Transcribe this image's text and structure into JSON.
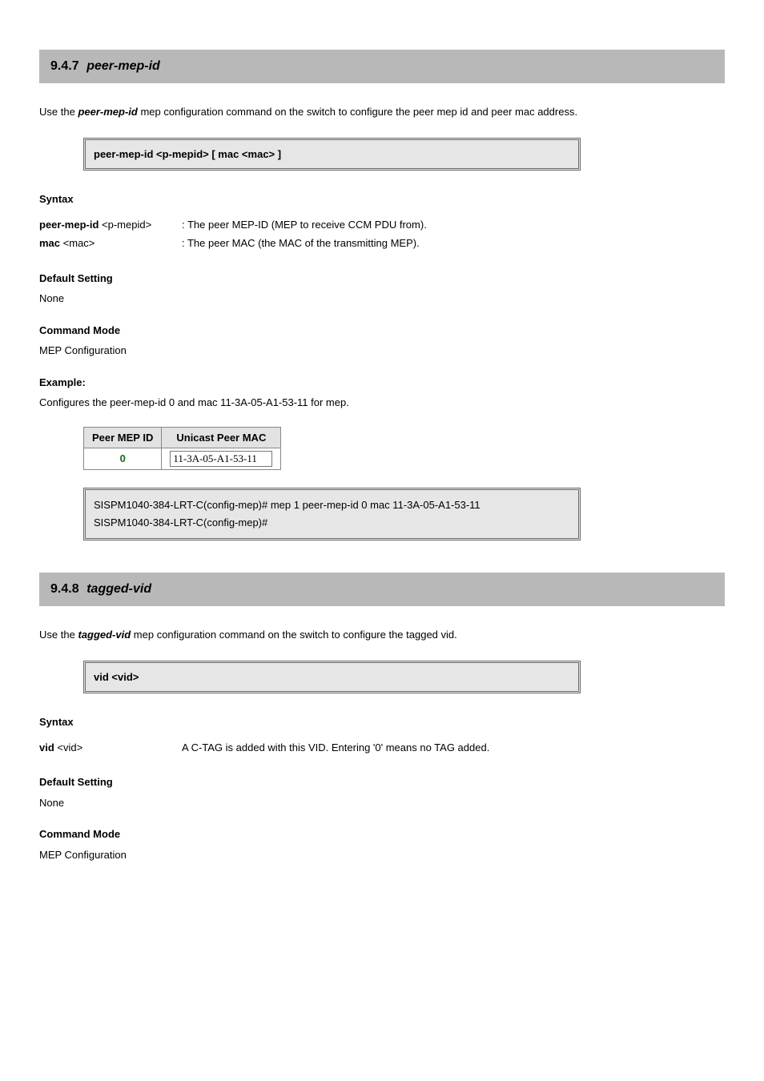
{
  "sections": [
    {
      "num": "9.4.7",
      "title": "peer-mep-id"
    },
    {
      "num": "9.4.8",
      "title": "tagged-vid"
    }
  ],
  "s1": {
    "intro_prefix": "Use the",
    "intro_func": "peer-mep-id",
    "intro_suffix": "mep configuration command on the switch to configure the peer mep id and peer mac address.",
    "syntax_box": "peer-mep-id <p-mepid> [ mac <mac> ]",
    "syntax_label": "Syntax",
    "params": {
      "p1_key": "peer-mep-id",
      "p1_type": "<p-mepid>",
      "p1_desc": ": The peer MEP-ID (MEP to receive CCM PDU from).",
      "p2_key": "mac",
      "p2_type": "<mac>",
      "p2_desc": ": The peer MAC (the MAC of the transmitting MEP)."
    },
    "default_head": "Default Setting",
    "default_body": "None",
    "mode_head": "Command Mode",
    "mode_body": "MEP Configuration",
    "example_head": "Example:",
    "example_text": "Configures the peer-mep-id 0 and mac 11-3A-05-A1-53-11 for mep.",
    "table": {
      "col1": "Peer MEP ID",
      "col2": "Unicast Peer MAC",
      "row1_id": "0",
      "row1_mac": "11-3A-05-A1-53-11"
    },
    "cmd_box": "SISPM1040-384-LRT-C(config-mep)# mep 1 peer-mep-id 0 mac 11-3A-05-A1-53-11\nSISPM1040-384-LRT-C(config-mep)#"
  },
  "s2": {
    "intro_prefix": "Use the",
    "intro_func": "tagged-vid",
    "intro_suffix": "mep configuration command on the switch to configure the tagged vid.",
    "syntax_box": "vid <vid>",
    "syntax_label": "Syntax",
    "params": {
      "p1_key": "vid",
      "p1_type": "<vid>",
      "p1_desc": "A C-TAG is added with this VID. Entering '0' means no TAG added."
    },
    "default_head": "Default Setting",
    "default_body": "None",
    "mode_head": "Command Mode",
    "mode_body": "MEP Configuration"
  }
}
